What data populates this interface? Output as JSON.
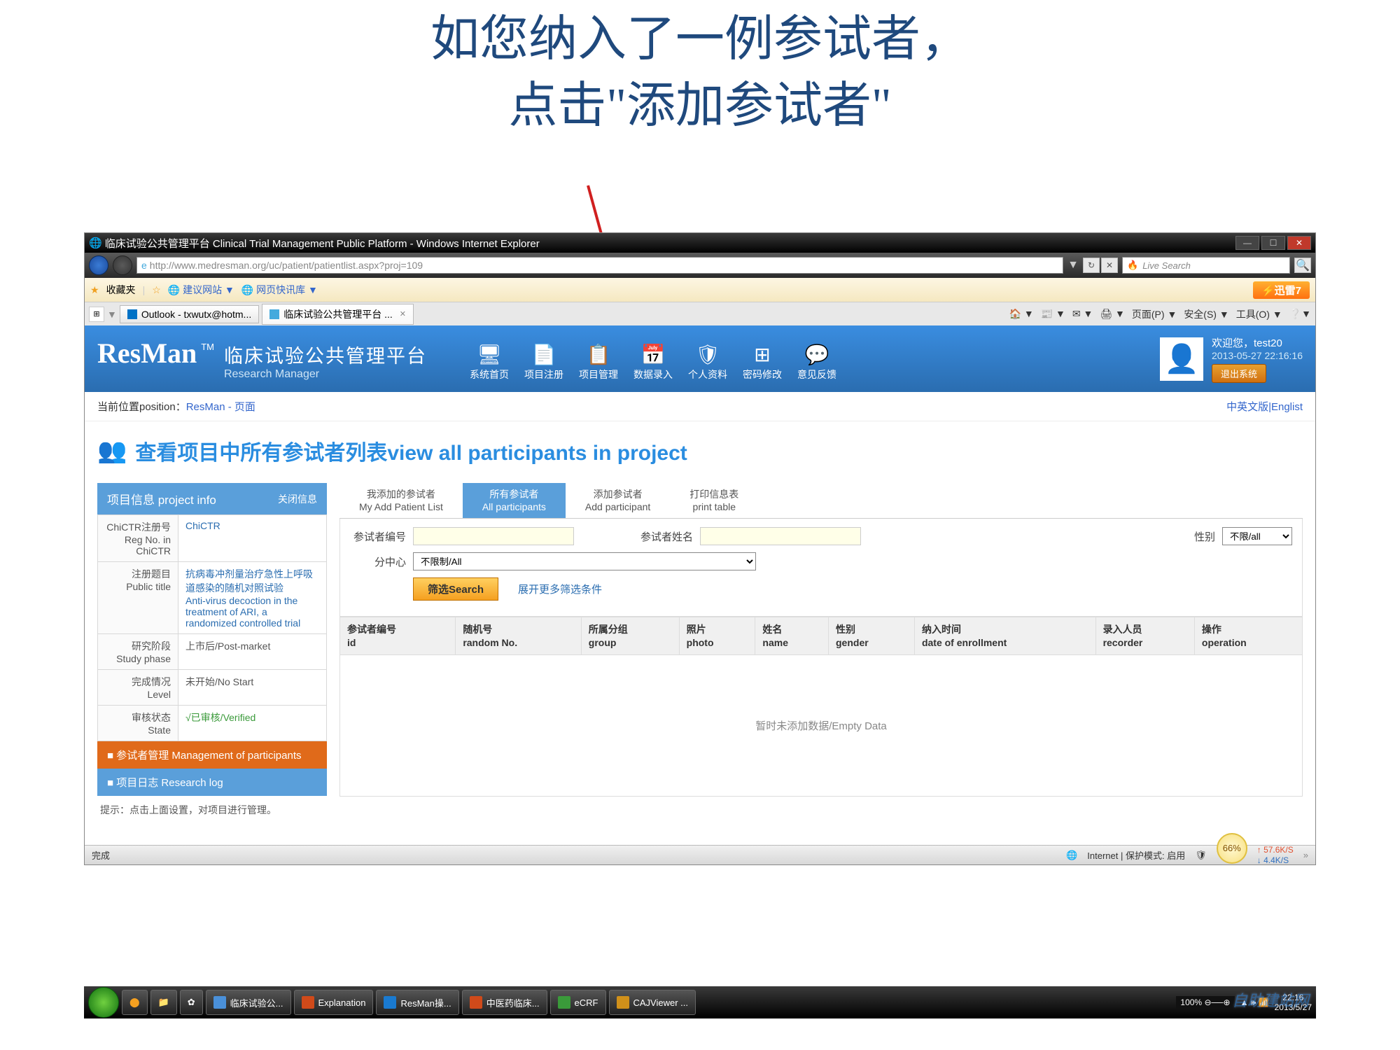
{
  "slide": {
    "title_line1": "如您纳入了一例参试者，",
    "title_line2": "点击\"添加参试者\""
  },
  "browser": {
    "window_title": "临床试验公共管理平台 Clinical Trial Management Public Platform - Windows Internet Explorer",
    "url": "http://www.medresman.org/uc/patient/patientlist.aspx?proj=109",
    "search_placeholder": "Live Search",
    "favorites_label": "收藏夹",
    "fav_suggest": "建议网站 ▼",
    "fav_quick": "网页快讯库 ▼",
    "thunder": "迅雷7",
    "tab1": "Outlook - txwutx@hotm...",
    "tab2": "临床试验公共管理平台 ...",
    "toolbar": {
      "page": "页面(P) ▼",
      "safety": "安全(S) ▼",
      "tools": "工具(O) ▼"
    }
  },
  "app": {
    "logo_main": "ResMan",
    "logo_tm": "TM",
    "logo_cn": "临床试验公共管理平台",
    "logo_en": "Research Manager",
    "nav": [
      "系统首页",
      "项目注册",
      "项目管理",
      "数据录入",
      "个人资料",
      "密码修改",
      "意见反馈"
    ],
    "nav_icons": [
      "🖥",
      "📄",
      "📋",
      "📅",
      "🛡",
      "⊞",
      "💬"
    ],
    "welcome": "欢迎您，test20",
    "datetime": "2013-05-27 22:16:16",
    "logout": "退出系统",
    "breadcrumb_label": "当前位置position：",
    "breadcrumb_link": "ResMan",
    "breadcrumb_tail": " - 页面",
    "lang_link": "中英文版|Englist",
    "page_heading": "查看项目中所有参试者列表view all participants in project"
  },
  "sidebar": {
    "header": "项目信息 project info",
    "close": "关闭信息",
    "rows": [
      {
        "label": "ChiCTR注册号\nReg No. in ChiCTR",
        "value": "ChiCTR"
      },
      {
        "label": "注册题目\nPublic title",
        "value": "抗病毒冲剂量治疗急性上呼吸道感染的随机对照试验\nAnti-virus decoction in the treatment of ARI, a randomized controlled trial"
      },
      {
        "label": "研究阶段\nStudy phase",
        "value": "上市后/Post-market"
      },
      {
        "label": "完成情况\nLevel",
        "value": "未开始/No Start"
      },
      {
        "label": "审核状态\nState",
        "value": "√已审核/Verified"
      }
    ],
    "mgmt": "■ 参试者管理 Management of participants",
    "log": "■ 项目日志 Research log",
    "hint": "提示：点击上面设置，对项目进行管理。"
  },
  "tabs": [
    {
      "line1": "我添加的参试者",
      "line2": "My Add Patient List"
    },
    {
      "line1": "所有参试者",
      "line2": "All participants"
    },
    {
      "line1": "添加参试者",
      "line2": "Add participant"
    },
    {
      "line1": "打印信息表",
      "line2": "print table"
    }
  ],
  "filters": {
    "id_label": "参试者编号",
    "name_label": "参试者姓名",
    "gender_label": "性别",
    "gender_value": "不限/all",
    "center_label": "分中心",
    "center_value": "不限制/All",
    "search_btn": "筛选Search",
    "more": "展开更多筛选条件"
  },
  "table": {
    "headers": [
      {
        "cn": "参试者编号",
        "en": "id"
      },
      {
        "cn": "随机号",
        "en": "random No."
      },
      {
        "cn": "所属分组",
        "en": "group"
      },
      {
        "cn": "照片",
        "en": "photo"
      },
      {
        "cn": "姓名",
        "en": "name"
      },
      {
        "cn": "性别",
        "en": "gender"
      },
      {
        "cn": "纳入时间",
        "en": "date of enrollment"
      },
      {
        "cn": "录入人员",
        "en": "recorder"
      },
      {
        "cn": "操作",
        "en": "operation"
      }
    ],
    "empty": "暂时未添加数据/Empty Data"
  },
  "statusbar": {
    "done": "完成",
    "internet": "Internet | 保护模式: 启用",
    "zoom_pct": "66%",
    "net_up": "↑ 57.6K/S",
    "net_dn": "↓ 4.4K/S"
  },
  "taskbar": {
    "items": [
      "临床试验公...",
      "Explanation",
      "ResMan操...",
      "中医药临床...",
      "eCRF",
      "CAJViewer ..."
    ],
    "zoom": "100%",
    "time": "22:16\n2013/5/27"
  },
  "watermark": "自助建站网"
}
